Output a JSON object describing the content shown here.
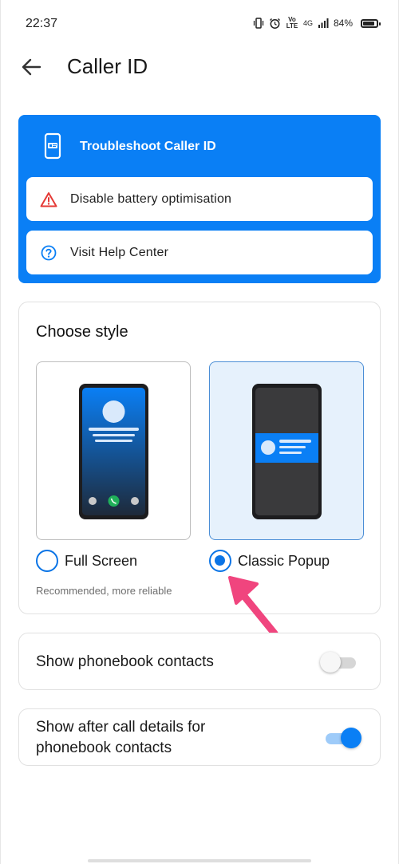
{
  "status_bar": {
    "time": "22:37",
    "lte_label": "Vo LTE",
    "network_label": "4G",
    "battery_percent": "84%"
  },
  "app_bar": {
    "title": "Caller ID",
    "back_icon": "arrow-left-icon"
  },
  "troubleshoot": {
    "title": "Troubleshoot Caller ID",
    "items": [
      {
        "label": "Disable battery optimisation",
        "icon": "warning-triangle-icon"
      },
      {
        "label": "Visit Help Center",
        "icon": "help-circle-icon"
      }
    ],
    "colors": {
      "background": "#0a7ff5",
      "warning": "#e53935",
      "help": "#0a7ff5"
    }
  },
  "style_section": {
    "title": "Choose style",
    "options": [
      {
        "label": "Full Screen",
        "selected": false,
        "hint": "Recommended, more reliable"
      },
      {
        "label": "Classic Popup",
        "selected": true
      }
    ]
  },
  "settings": [
    {
      "label": "Show phonebook contacts",
      "enabled": false
    },
    {
      "label": "Show after call details for phonebook contacts",
      "enabled": true
    }
  ],
  "colors": {
    "accent": "#0a7ff5",
    "annotation_arrow": "#f0457e"
  }
}
